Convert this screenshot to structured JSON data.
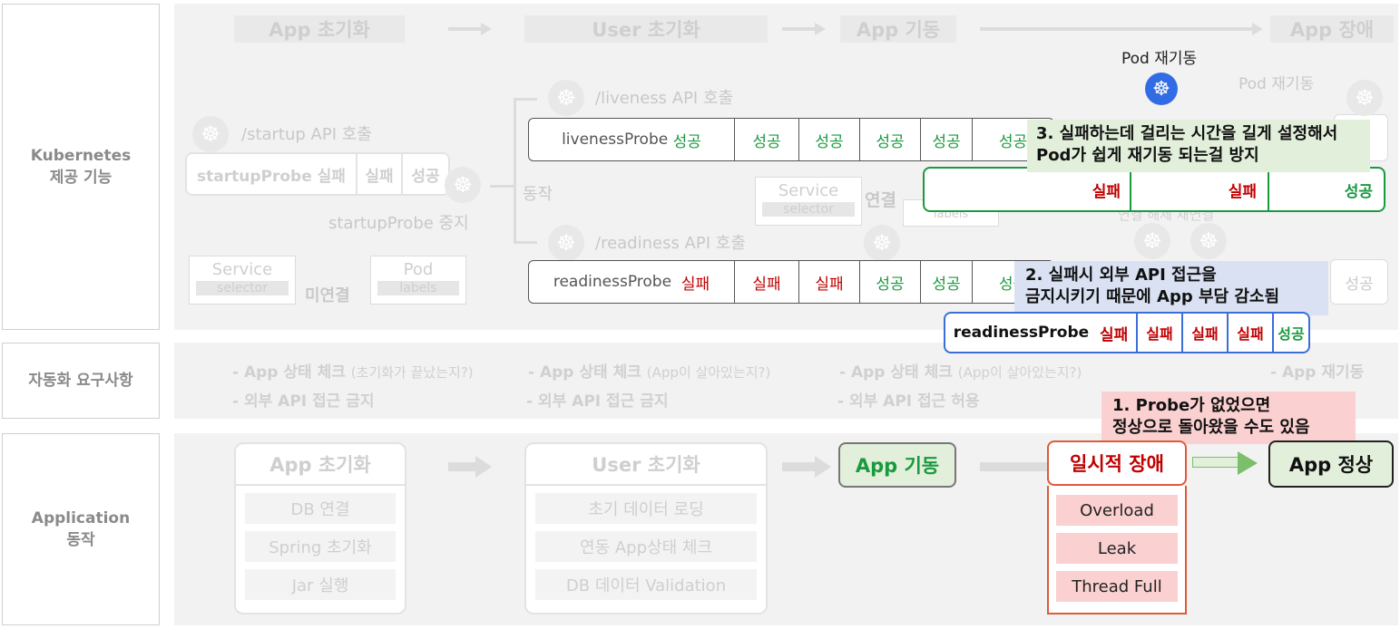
{
  "rows": {
    "k8s": "Kubernetes\n제공 기능",
    "auto": "자동화 요구사항",
    "app": "Application\n동작"
  },
  "top_headers": {
    "init": "App 초기화",
    "user": "User 초기화",
    "start": "App 기동",
    "fault": "App 장애"
  },
  "startup": {
    "api": "/startup API 호출",
    "probe": "startupProbe 실패",
    "c1": "실패",
    "c2": "성공",
    "stop": "startupProbe 중지",
    "act": "동작"
  },
  "liveness": {
    "api": "/liveness API 호출",
    "probe": "livenessProbe",
    "status": "성공",
    "cells": [
      "성공",
      "성공",
      "성공",
      "성공",
      "성공"
    ],
    "overlay": [
      "실패",
      "실패",
      "성공"
    ]
  },
  "readiness": {
    "api": "/readiness API 호출",
    "probe": "readinessProbe",
    "status": "실패",
    "cells": [
      "실패",
      "실패",
      "성공",
      "성공",
      "성공"
    ],
    "tail": "성공",
    "overlay_probe": "readinessProbe",
    "overlay_status": "실패",
    "overlay_cells": [
      "실패",
      "실패",
      "실패",
      "성공"
    ]
  },
  "pod_restart": "Pod 재기동",
  "pod_restart_faded": "Pod 재기동",
  "service": {
    "name": "Service",
    "selector": "selector",
    "connect": "연결",
    "labels": "labels",
    "unconnected": "미연결",
    "pod": "Pod",
    "pod_labels": "labels",
    "faded_tail": "연결 해제 재연결"
  },
  "notes": {
    "n3": "3. 실패하는데 걸리는 시간을 길게 설정해서\n    Pod가 쉽게 재기동 되는걸 방지",
    "n2": "2. 실패시 외부 API 접근을\n    금지시키기 때문에 App 부담 감소됨",
    "n1": "1. Probe가 없었으면\n    정상으로 돌아왔을 수도 있음"
  },
  "requirements": {
    "c1a": "- App 상태 체크",
    "c1a_s": "(초기화가 끝났는지?)",
    "c1b": "- 외부 API 접근 금지",
    "c2a": "- App 상태 체크",
    "c2a_s": "(App이 살아있는지?)",
    "c2b": "- 외부 API 접근 금지",
    "c3a": "- App 상태 체크",
    "c3a_s": "(App이 살아있는지?)",
    "c3b": "- 외부 API 접근 허용",
    "c4": "- App 재기동"
  },
  "app": {
    "init": "App 초기화",
    "init_items": [
      "DB 연결",
      "Spring 초기화",
      "Jar 실행"
    ],
    "user": "User 초기화",
    "user_items": [
      "초기 데이터 로딩",
      "연동 App상태 체크",
      "DB 데이터 Validation"
    ],
    "start": "App 기동",
    "fault": "일시적 장애",
    "fault_items": [
      "Overload",
      "Leak",
      "Thread Full"
    ],
    "normal": "App 정상"
  },
  "colors": {
    "ok": "#1a9a3e",
    "fail": "#c00000",
    "k8s_blue": "#326ce5",
    "note3": "#e2efda",
    "note2": "#d9e1f2",
    "note1": "#fbd0d0"
  }
}
